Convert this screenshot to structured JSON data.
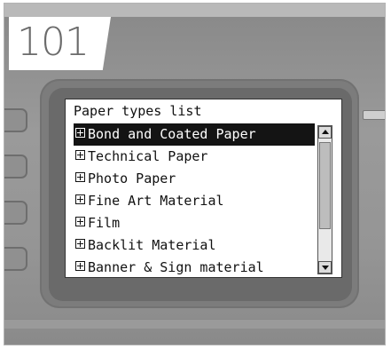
{
  "step": {
    "number": "101"
  },
  "screen": {
    "title": "Paper types list",
    "selected_index": 0,
    "items": [
      {
        "label": "Bond and Coated Paper",
        "icon": "expand-plus-icon"
      },
      {
        "label": "Technical Paper",
        "icon": "expand-plus-icon"
      },
      {
        "label": "Photo Paper",
        "icon": "expand-plus-icon"
      },
      {
        "label": "Fine Art Material",
        "icon": "expand-plus-icon"
      },
      {
        "label": "Film",
        "icon": "expand-plus-icon"
      },
      {
        "label": "Backlit Material",
        "icon": "expand-plus-icon"
      },
      {
        "label": "Banner & Sign material",
        "icon": "expand-plus-icon"
      }
    ]
  },
  "scrollbar": {
    "up_icon": "arrow-up-icon",
    "down_icon": "arrow-down-icon"
  },
  "colors": {
    "selected_bg": "#141414",
    "panel": "#959595",
    "screen_bg": "#ffffff"
  }
}
